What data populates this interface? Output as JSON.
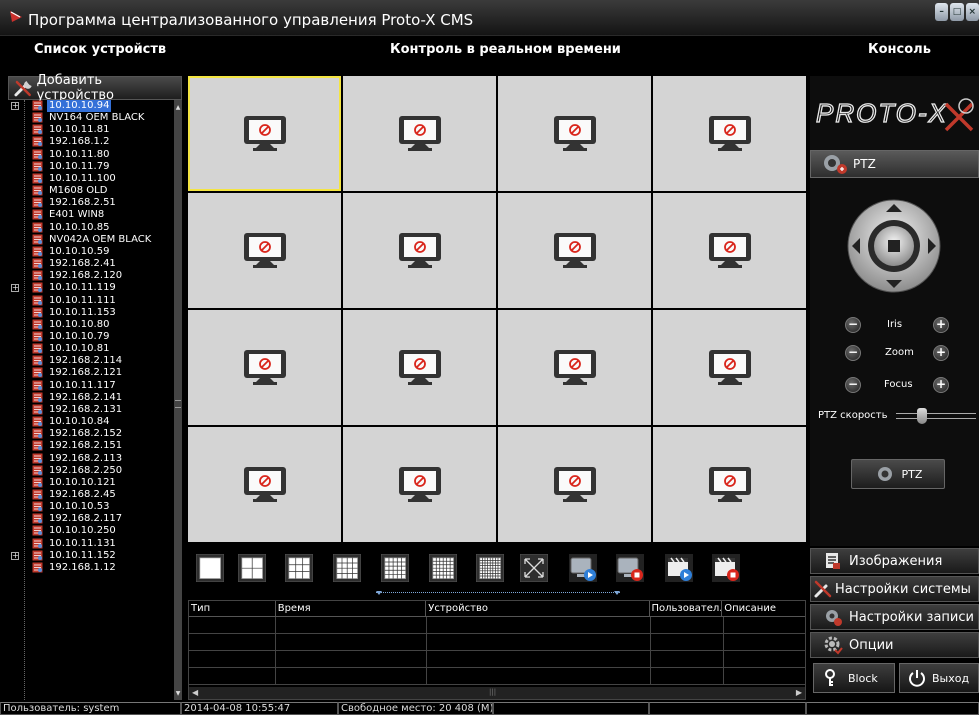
{
  "window": {
    "title": "Программа централизованного управления Proto-X CMS"
  },
  "headers": {
    "devices": "Список устройств",
    "realtime": "Контроль в реальном времени",
    "console": "Консоль"
  },
  "sidebar": {
    "add_device_label": "Добавить устройство",
    "devices": [
      {
        "label": "10.10.10.94",
        "selected": true,
        "expandable": true
      },
      {
        "label": "NV164 OEM BLACK"
      },
      {
        "label": "10.10.11.81"
      },
      {
        "label": "192.168.1.2"
      },
      {
        "label": "10.10.11.80"
      },
      {
        "label": "10.10.11.79"
      },
      {
        "label": "10.10.11.100"
      },
      {
        "label": "M1608 OLD"
      },
      {
        "label": "192.168.2.51"
      },
      {
        "label": "E401 WIN8"
      },
      {
        "label": "10.10.10.85"
      },
      {
        "label": "NV042A OEM BLACK"
      },
      {
        "label": "10.10.10.59"
      },
      {
        "label": "192.168.2.41"
      },
      {
        "label": "192.168.2.120"
      },
      {
        "label": "10.10.11.119",
        "expandable": true
      },
      {
        "label": "10.10.11.111"
      },
      {
        "label": "10.10.11.153"
      },
      {
        "label": "10.10.10.80"
      },
      {
        "label": "10.10.10.79"
      },
      {
        "label": "10.10.10.81"
      },
      {
        "label": "192.168.2.114"
      },
      {
        "label": "192.168.2.121"
      },
      {
        "label": "10.10.11.117"
      },
      {
        "label": "192.168.2.141"
      },
      {
        "label": "192.168.2.131"
      },
      {
        "label": "10.10.10.84"
      },
      {
        "label": "192.168.2.152"
      },
      {
        "label": "192.168.2.151"
      },
      {
        "label": "192.168.2.113"
      },
      {
        "label": "192.168.2.250"
      },
      {
        "label": "10.10.10.121"
      },
      {
        "label": "192.168.2.45"
      },
      {
        "label": "10.10.10.53"
      },
      {
        "label": "192.168.2.117"
      },
      {
        "label": "10.10.10.250"
      },
      {
        "label": "10.10.11.131"
      },
      {
        "label": "10.10.11.152",
        "expandable": true
      },
      {
        "label": "192.168.1.12"
      }
    ]
  },
  "layout_buttons": [
    "layout-1",
    "layout-4",
    "layout-9",
    "layout-16",
    "layout-25",
    "layout-36",
    "layout-64",
    "fullscreen",
    "start-all-video",
    "stop-all-video",
    "start-recording",
    "stop-recording"
  ],
  "event_log": {
    "columns": [
      "Тип",
      "Время",
      "Устройство",
      "Пользовател.",
      "Описание"
    ]
  },
  "console": {
    "ptz_header": "PTZ",
    "iris": "Iris",
    "zoom": "Zoom",
    "focus": "Focus",
    "speed_label": "PTZ скорость",
    "speed_value": 0.3,
    "ptz_button": "PTZ"
  },
  "menu": {
    "images": "Изображения",
    "system_settings": "Настройки системы",
    "record_settings": "Настройки записи",
    "options": "Опции",
    "block": "Block",
    "exit": "Выход"
  },
  "status": {
    "user": "Пользователь: system",
    "datetime": "2014-04-08 10:55:47",
    "free_space": "Свободное место: 20 408 (M)"
  },
  "colors": {
    "accent_selected": "#3470d8",
    "active_cell": "#f4e542",
    "cell_bg": "#d4d4d4",
    "no_signal_red": "#d9261c"
  }
}
